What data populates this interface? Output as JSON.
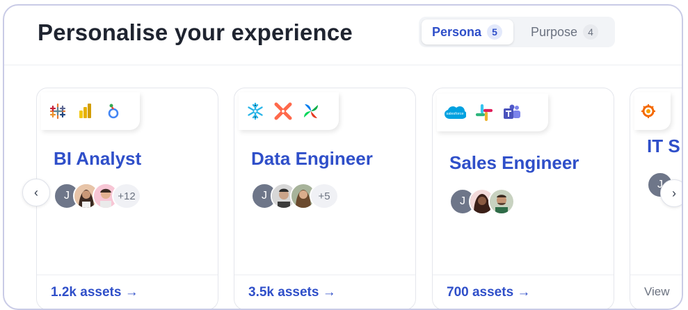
{
  "header": {
    "title": "Personalise your experience"
  },
  "tabs": [
    {
      "label": "Persona",
      "count": "5",
      "active": true
    },
    {
      "label": "Purpose",
      "count": "4",
      "active": false
    }
  ],
  "cards": [
    {
      "title": "BI Analyst",
      "icons": [
        "tableau-icon",
        "powerbi-icon",
        "looker-icon"
      ],
      "avatar_initial": "J",
      "more": "+12",
      "assets": "1.2k assets →"
    },
    {
      "title": "Data Engineer",
      "icons": [
        "snowflake-icon",
        "dbt-icon",
        "airflow-icon"
      ],
      "avatar_initial": "J",
      "more": "+5",
      "assets": "3.5k assets →"
    },
    {
      "title": "Sales Engineer",
      "icons": [
        "salesforce-icon",
        "slack-icon",
        "teams-icon"
      ],
      "avatar_initial": "J",
      "more": "",
      "assets": "700 assets →"
    },
    {
      "title": "IT S",
      "icons": [
        "grafana-icon"
      ],
      "avatar_initial": "J",
      "more": "",
      "assets": "View"
    }
  ],
  "nav": {
    "prev": "‹",
    "next": "›"
  },
  "colors": {
    "accent": "#2f4fc9",
    "title": "#1f2430",
    "border": "#c9cbe6"
  },
  "salesforce_text": "salesforce"
}
